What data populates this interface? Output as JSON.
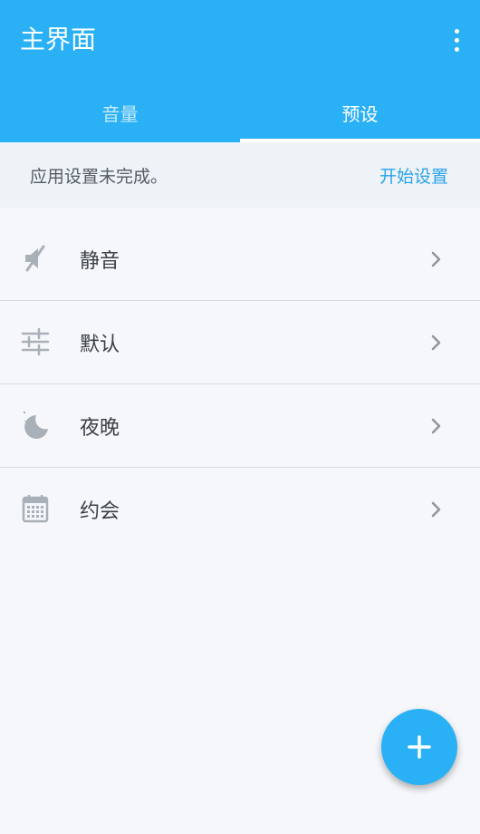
{
  "app": {
    "title": "主界面"
  },
  "tabs": [
    {
      "label": "音量",
      "active": false
    },
    {
      "label": "预设",
      "active": true
    }
  ],
  "banner": {
    "message": "应用设置未完成。",
    "action": "开始设置"
  },
  "presets": [
    {
      "label": "静音",
      "icon": "mute-icon"
    },
    {
      "label": "默认",
      "icon": "sliders-icon"
    },
    {
      "label": "夜晚",
      "icon": "moon-star-icon"
    },
    {
      "label": "约会",
      "icon": "calendar-icon"
    }
  ],
  "colors": {
    "primary": "#2ab0f5",
    "accent_text": "#2aa3e8",
    "background": "#f5f7fa",
    "banner_bg": "#eef3f8"
  },
  "fab": {
    "icon": "plus-icon"
  }
}
